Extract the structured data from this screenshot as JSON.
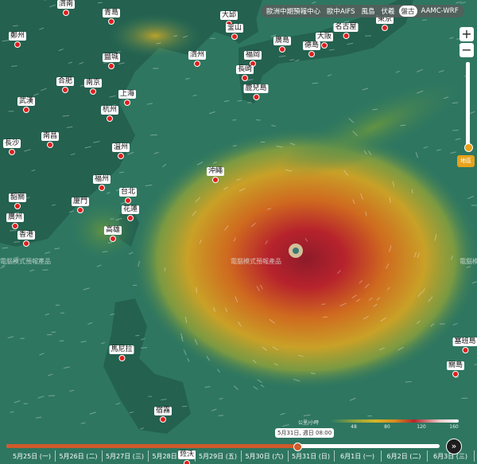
{
  "top_tabs": [
    {
      "label": "歐洲中期預報中心",
      "active": false
    },
    {
      "label": "歐中AIFS",
      "active": false
    },
    {
      "label": "風島",
      "active": false
    },
    {
      "label": "伏羲",
      "active": false
    },
    {
      "label": "盤古",
      "active": true
    },
    {
      "label": "AAMC-WRF",
      "active": false
    }
  ],
  "zoom": {
    "plus": "+",
    "minus": "−"
  },
  "layer_button": "地區",
  "cities": [
    {
      "name": "濟南"
    },
    {
      "name": "青島"
    },
    {
      "name": "大邱"
    },
    {
      "name": "東京"
    },
    {
      "name": "釜山"
    },
    {
      "name": "名古屋"
    },
    {
      "name": "廣島"
    },
    {
      "name": "大阪"
    },
    {
      "name": "鄭州"
    },
    {
      "name": "德島"
    },
    {
      "name": "濟州"
    },
    {
      "name": "福岡"
    },
    {
      "name": "鹽城"
    },
    {
      "name": "長崎"
    },
    {
      "name": "合肥"
    },
    {
      "name": "南京"
    },
    {
      "name": "鹿兒島"
    },
    {
      "name": "上海"
    },
    {
      "name": "武漢"
    },
    {
      "name": "杭州"
    },
    {
      "name": "南昌"
    },
    {
      "name": "長沙"
    },
    {
      "name": "溫州"
    },
    {
      "name": "沖繩"
    },
    {
      "name": "福州"
    },
    {
      "name": "台北"
    },
    {
      "name": "韶關"
    },
    {
      "name": "廈門"
    },
    {
      "name": "花蓮"
    },
    {
      "name": "廣州"
    },
    {
      "name": "高雄"
    },
    {
      "name": "香港"
    },
    {
      "name": "馬尼拉"
    },
    {
      "name": "塞班島"
    },
    {
      "name": "關島"
    },
    {
      "name": "宿霧"
    },
    {
      "name": "薩沃"
    }
  ],
  "watermark": "電腦模式預報產品",
  "legend": {
    "unit": "公里/小時",
    "ticks": [
      "48",
      "80",
      "120",
      "160"
    ]
  },
  "timeline": {
    "bubble": "5月31日, 週日 08:00",
    "days": [
      "5月25日 (一)",
      "5月26日 (二)",
      "5月27日 (三)",
      "5月28日 (四)",
      "5月29日 (五)",
      "5月30日 (六)",
      "5月31日 (日)",
      "6月1日 (一)",
      "6月2日 (二)",
      "6月3日 (三)"
    ],
    "next_label": "»",
    "progress": 0.67
  },
  "colors": {
    "background": "#2f7a62",
    "storm_core": "#b3262c",
    "accent": "#e8a21b",
    "city_dot": "#e0201e"
  }
}
